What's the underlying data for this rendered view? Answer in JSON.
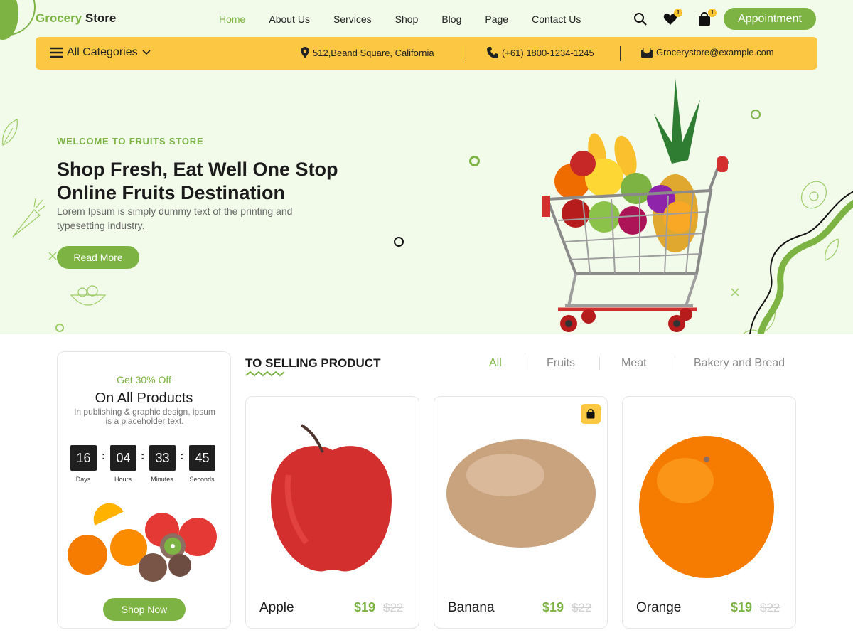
{
  "header": {
    "logo_green": "Grocery",
    "logo_dark": " Store",
    "nav": [
      {
        "label": "Home",
        "active": true
      },
      {
        "label": "About Us"
      },
      {
        "label": "Services"
      },
      {
        "label": "Shop"
      },
      {
        "label": "Blog"
      },
      {
        "label": "Page"
      },
      {
        "label": "Contact Us"
      }
    ],
    "wishlist_count": "1",
    "cart_count": "1",
    "appointment_label": "Appointment"
  },
  "infobar": {
    "categories_label": "All Categories",
    "address": "512,Beand Square, California",
    "phone": "(+61) 1800-1234-1245",
    "email": "Grocerystore@example.com"
  },
  "hero": {
    "eyebrow": "WELCOME TO FRUITS STORE",
    "headline": "Shop Fresh, Eat Well One Stop Online Fruits Destination",
    "description": "Lorem Ipsum is simply dummy text of the printing and typesetting industry.",
    "cta_label": "Read More"
  },
  "promo": {
    "offer": "Get 30% Off",
    "title": "On All Products",
    "description": "In publishing & graphic design, ipsum is a placeholder text.",
    "countdown": [
      {
        "value": "16",
        "label": "Days"
      },
      {
        "value": "04",
        "label": "Hours"
      },
      {
        "value": "33",
        "label": "Minutes"
      },
      {
        "value": "45",
        "label": "Seconds"
      }
    ],
    "cta_label": "Shop Now"
  },
  "products_section": {
    "title": "TO SELLING PRODUCT",
    "filters": [
      {
        "label": "All",
        "active": true
      },
      {
        "label": "Fruits"
      },
      {
        "label": "Meat"
      },
      {
        "label": "Bakery and Bread"
      }
    ],
    "products": [
      {
        "name": "Apple",
        "price": "$19",
        "old_price": "$22"
      },
      {
        "name": "Banana",
        "price": "$19",
        "old_price": "$22"
      },
      {
        "name": "Orange",
        "price": "$19",
        "old_price": "$22"
      }
    ]
  },
  "colors": {
    "accent_green": "#7cb342",
    "accent_yellow": "#fcc844",
    "hero_bg": "#f2fbea"
  }
}
